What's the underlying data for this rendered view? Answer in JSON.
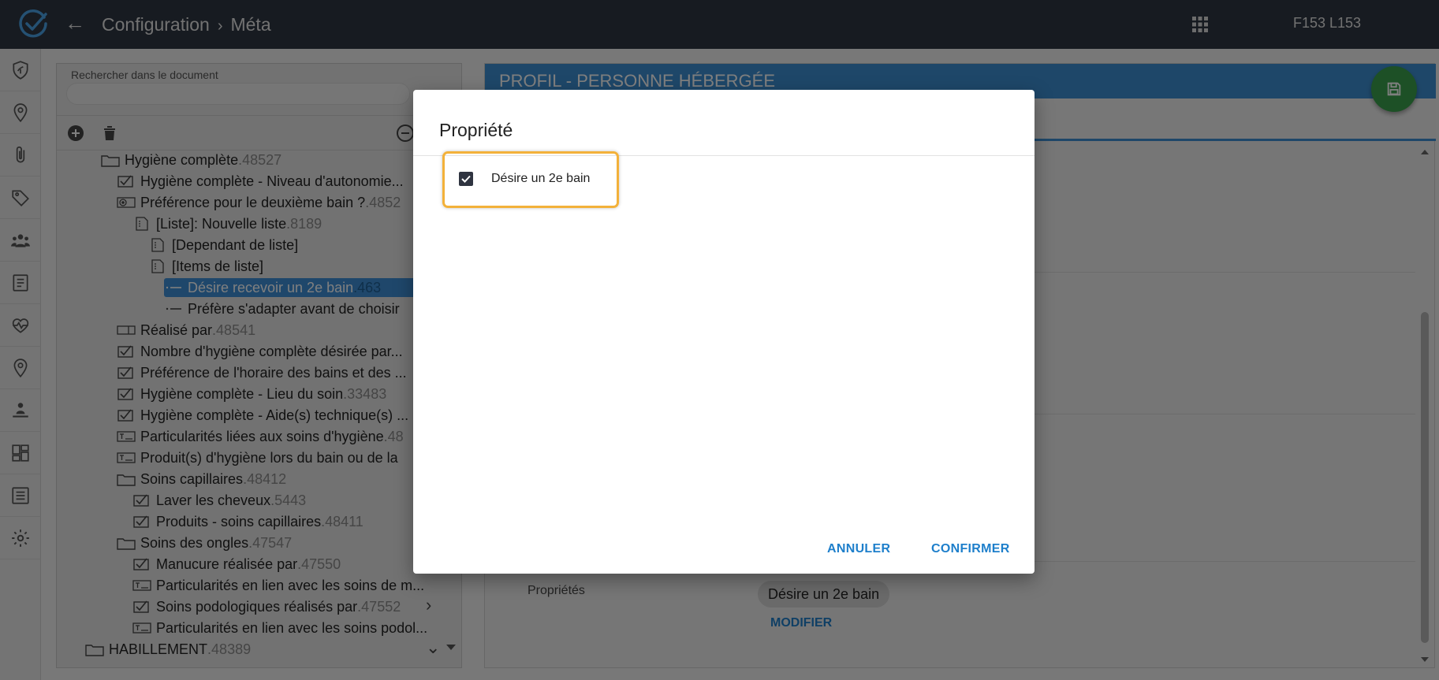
{
  "header": {
    "breadcrumb": [
      "Configuration",
      "Méta"
    ],
    "user_label": "F153 L153"
  },
  "rail": {
    "items": [
      "shield-plant-icon",
      "location-pin-icon",
      "paperclip-icon",
      "tag-icon",
      "people-group-icon",
      "document-list-icon",
      "heartbeat-icon",
      "location-pin-icon",
      "person-care-icon",
      "dashboard-icon",
      "list-icon",
      "gear-icon"
    ]
  },
  "tree_panel": {
    "search_label": "Rechercher dans le document",
    "search_value": "",
    "rows": [
      {
        "label": "Hygiène complète",
        "num": ".48527",
        "icon": "folder"
      },
      {
        "label": "Hygiène complète - Niveau d'autonomie...",
        "num": "",
        "icon": "checkbox"
      },
      {
        "label": "Préférence pour le deuxième bain ?",
        "num": ".4852",
        "icon": "radio"
      },
      {
        "label": "[Liste]: Nouvelle liste",
        "num": ".8189",
        "icon": "doc"
      },
      {
        "label": "[Dependant de liste]",
        "num": "",
        "icon": "doc"
      },
      {
        "label": "[Items de liste]",
        "num": "",
        "icon": "doc"
      },
      {
        "label": "Désire recevoir un 2e bain",
        "num": ".463",
        "icon": "dash"
      },
      {
        "label": "Préfère s'adapter avant de choisir",
        "num": "",
        "icon": "dash"
      },
      {
        "label": "Réalisé par",
        "num": ".48541",
        "icon": "field"
      },
      {
        "label": "Nombre d'hygiène complète désirée par...",
        "num": "",
        "icon": "checkbox"
      },
      {
        "label": "Préférence de l'horaire des bains et des ...",
        "num": "",
        "icon": "checkbox"
      },
      {
        "label": "Hygiène complète - Lieu du soin",
        "num": ".33483",
        "icon": "checkbox"
      },
      {
        "label": "Hygiène complète - Aide(s) technique(s) ...",
        "num": "",
        "icon": "checkbox"
      },
      {
        "label": "Particularités liées aux soins d'hygiène",
        "num": ".48",
        "icon": "text"
      },
      {
        "label": "Produit(s) d'hygiène lors du bain ou de la",
        "num": "",
        "icon": "text"
      },
      {
        "label": "Soins capillaires",
        "num": ".48412",
        "icon": "folder"
      },
      {
        "label": "Laver les cheveux",
        "num": ".5443",
        "icon": "checkbox"
      },
      {
        "label": "Produits - soins capillaires",
        "num": ".48411",
        "icon": "checkbox"
      },
      {
        "label": "Soins des ongles",
        "num": ".47547",
        "icon": "folder"
      },
      {
        "label": "Manucure réalisée par",
        "num": ".47550",
        "icon": "checkbox"
      },
      {
        "label": "Particularités en lien avec les soins de m...",
        "num": "",
        "icon": "text"
      },
      {
        "label": "Soins podologiques réalisés par",
        "num": ".47552",
        "icon": "checkbox"
      },
      {
        "label": "Particularités en lien avec les soins podol...",
        "num": "",
        "icon": "text"
      },
      {
        "label": "HABILLEMENT",
        "num": ".48389",
        "icon": "folder"
      }
    ]
  },
  "content": {
    "title": "PROFIL - PERSONNE HÉBERGÉE",
    "properties_label": "Propriétés",
    "property_chip": "Désire un 2e bain",
    "modify_label": "MODIFIER"
  },
  "dialog": {
    "title": "Propriété",
    "checkbox_label": "Désire un 2e bain",
    "checkbox_checked": true,
    "cancel_label": "ANNULER",
    "confirm_label": "CONFIRMER"
  },
  "colors": {
    "topbar": "#2e3642",
    "accent_blue": "#3d8fd2",
    "selection": "#3e8fd6",
    "fab_green": "#3aa14c",
    "highlight": "#f3b13a",
    "link_blue": "#1e7fcb"
  }
}
